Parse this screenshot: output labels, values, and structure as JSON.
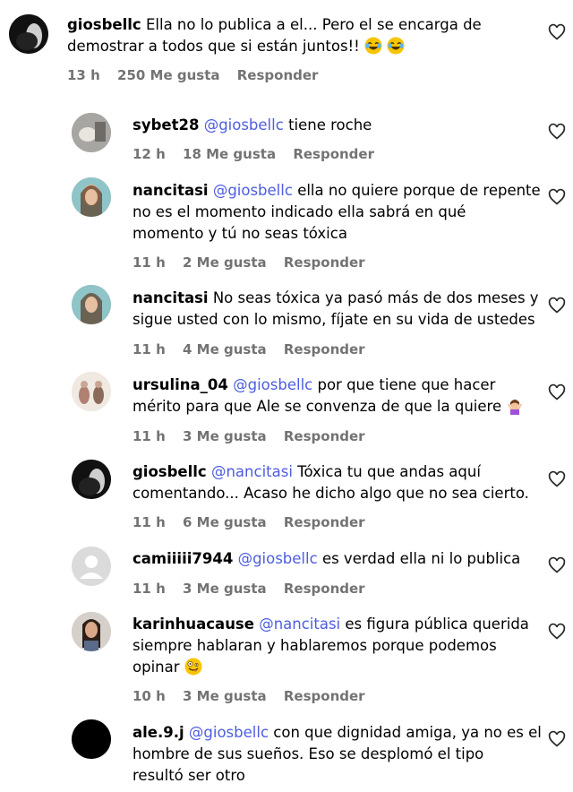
{
  "comments": [
    {
      "user": "giosbellc",
      "mention": "",
      "text": "Ella no lo publica a el... Pero el se encarga de",
      "line2": "demostrar a todos que si están juntos!!",
      "line3": "",
      "emoji": "joy",
      "time": "13 h",
      "likes": "250 Me gusta",
      "reply": "Responder"
    },
    {
      "user": "sybet28",
      "mention": "@giosbellc",
      "text": "tiene roche",
      "line2": "",
      "line3": "",
      "time": "12 h",
      "likes": "18 Me gusta",
      "reply": "Responder"
    },
    {
      "user": "nancitasi",
      "mention": "@giosbellc",
      "text": "ella no quiere porque de repente",
      "line2": "no es el momento indicado ella sabrá en qué",
      "line3": "momento y tú no seas tóxica",
      "time": "11 h",
      "likes": "2 Me gusta",
      "reply": "Responder"
    },
    {
      "user": "nancitasi",
      "mention": "",
      "text": "No seas tóxica ya pasó más de dos meses y",
      "line2": "sigue usted con lo mismo, fíjate en su vida de ustedes",
      "line3": "",
      "time": "11 h",
      "likes": "4 Me gusta",
      "reply": "Responder"
    },
    {
      "user": "ursulina_04",
      "mention": "@giosbellc",
      "text": "por que tiene que hacer",
      "line2": "mérito para que Ale se convenza de que la quiere",
      "line3": "",
      "emoji": "shrug",
      "time": "11 h",
      "likes": "3 Me gusta",
      "reply": "Responder"
    },
    {
      "user": "giosbellc",
      "mention": "@nancitasi",
      "text": "Tóxica tu que andas aquí",
      "line2": "comentando... Acaso he dicho algo que no sea cierto.",
      "line3": "",
      "time": "11 h",
      "likes": "6 Me gusta",
      "reply": "Responder"
    },
    {
      "user": "camiiiii7944",
      "mention": "@giosbellc",
      "text": "es verdad ella ni lo publica",
      "line2": "",
      "line3": "",
      "time": "11 h",
      "likes": "3 Me gusta",
      "reply": "Responder"
    },
    {
      "user": "karinhuacause",
      "mention": "@nancitasi",
      "text": "es figura pública querida",
      "line2": "siempre hablaran y hablaremos porque podemos",
      "line3": "opinar",
      "emoji": "zany",
      "time": "10 h",
      "likes": "3 Me gusta",
      "reply": "Responder"
    },
    {
      "user": "ale.9.j",
      "mention": "@giosbellc",
      "text": "con que dignidad amiga, ya no es el",
      "line2": "hombre de sus sueños. Eso se desplomó el tipo",
      "line3": "resultó ser otro",
      "time": "",
      "likes": "",
      "reply": ""
    }
  ]
}
